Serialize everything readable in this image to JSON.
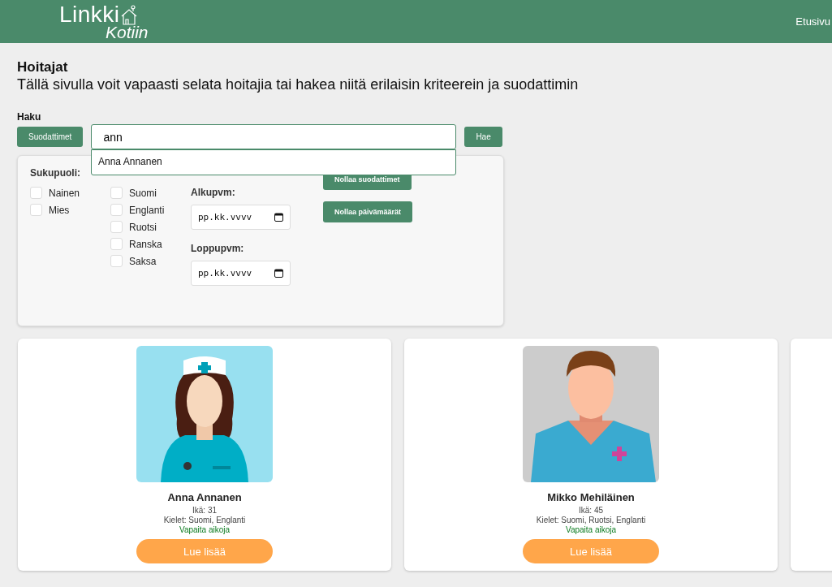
{
  "header": {
    "logo_top": "Linkki",
    "logo_bottom": "Kotiin",
    "nav": [
      {
        "label": "Etusivu"
      }
    ]
  },
  "page": {
    "title": "Hoitajat",
    "subtitle": "Tällä sivulla voit vapaasti selata hoitajia tai hakea niitä erilaisin kriteerein ja suodattimin"
  },
  "search": {
    "label": "Haku",
    "filters_button": "Suodattimet",
    "value": "ann",
    "search_button": "Hae",
    "suggestions": [
      {
        "label": "Anna Annanen"
      }
    ]
  },
  "filters": {
    "groups": [
      {
        "title": "Sukupuoli:",
        "options": [
          {
            "label": "Nainen",
            "checked": false
          },
          {
            "label": "Mies",
            "checked": false
          }
        ]
      },
      {
        "options": [
          {
            "label": "Suomi",
            "checked": false
          },
          {
            "label": "Englanti",
            "checked": false
          },
          {
            "label": "Ruotsi",
            "checked": false
          },
          {
            "label": "Ranska",
            "checked": false
          },
          {
            "label": "Saksa",
            "checked": false
          }
        ]
      }
    ],
    "schedule": {
      "dates": [
        {
          "label": "Alkupvm:",
          "placeholder": "pp.kk.vvvv"
        },
        {
          "label": "Loppupvm:",
          "placeholder": "pp.kk.vvvv"
        }
      ]
    },
    "buttons": [
      "Nollaa suodattimet",
      "Nollaa päivämäärät"
    ]
  },
  "nurses": [
    {
      "kind": "female",
      "name": "Anna Annanen",
      "age": "Ikä: 31",
      "languages": "Kielet: Suomi, Englanti",
      "availability": "Vapaita aikoja",
      "button": "Lue lisää"
    },
    {
      "kind": "male",
      "name": "Mikko Mehiläinen",
      "age": "Ikä: 45",
      "languages": "Kielet: Suomi, Ruotsi, Englanti",
      "availability": "Vapaita aikoja",
      "button": "Lue lisää"
    }
  ]
}
